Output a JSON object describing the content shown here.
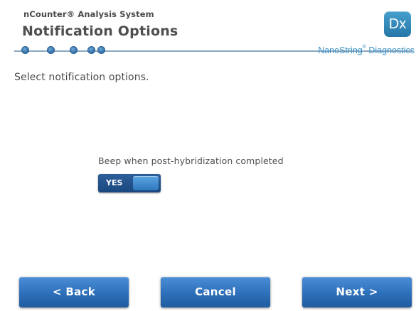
{
  "header": {
    "system_name": "nCounter® Analysis System",
    "title": "Notification Options",
    "logo_text": "Dx",
    "brand_name": "NanoString",
    "brand_mark": "®",
    "brand_suffix": " Diagnostics",
    "progress": {
      "total_steps": 5,
      "active_step": 5
    }
  },
  "main": {
    "instruction": "Select notification options.",
    "beep_option": {
      "label": "Beep when post-hybridization completed",
      "value": "YES",
      "enabled": true
    }
  },
  "footer": {
    "back_label": "<  Back",
    "cancel_label": "Cancel",
    "next_label": "Next  >"
  },
  "colors": {
    "button_blue": "#2d6fb9",
    "brand_blue": "#3c92c3",
    "toggle_blue": "#1a4780"
  }
}
